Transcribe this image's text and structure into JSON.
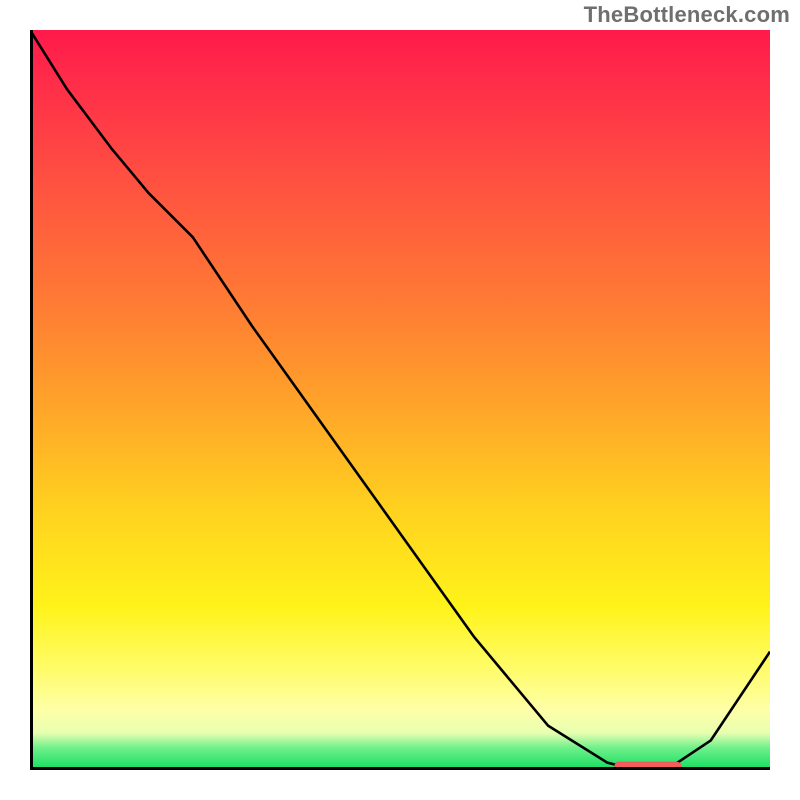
{
  "attribution": "TheBottleneck.com",
  "colors": {
    "top": "#ff1a4a",
    "mid_orange": "#ff9a30",
    "mid_yellow": "#fff31a",
    "bottom_green": "#13dd60",
    "curve": "#000000",
    "marker": "#f55d5d"
  },
  "chart_data": {
    "type": "line",
    "x": [
      0.0,
      0.05,
      0.11,
      0.16,
      0.22,
      0.3,
      0.4,
      0.5,
      0.6,
      0.7,
      0.78,
      0.82,
      0.86,
      0.92,
      0.96,
      1.0
    ],
    "values": [
      1.0,
      0.92,
      0.84,
      0.78,
      0.72,
      0.6,
      0.46,
      0.32,
      0.18,
      0.06,
      0.01,
      0.0,
      0.0,
      0.04,
      0.1,
      0.16
    ],
    "title": "",
    "xlabel": "",
    "ylabel": "",
    "xlim": [
      0,
      1
    ],
    "ylim": [
      0,
      1
    ],
    "marker_region_x": [
      0.79,
      0.88
    ],
    "marker_y": 0.004
  }
}
